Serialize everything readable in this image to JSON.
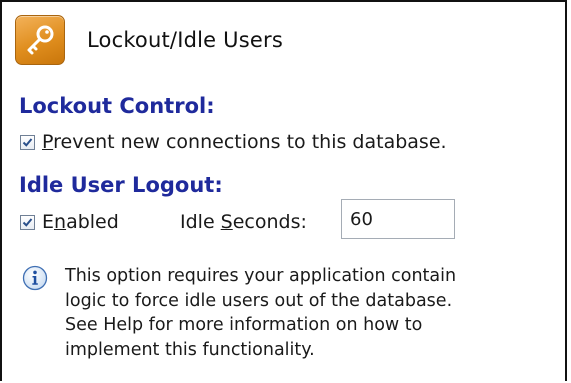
{
  "header": {
    "title": "Lockout/Idle Users",
    "icon": "key-icon",
    "icon_color": "#e08e1e"
  },
  "lockout": {
    "heading": "Lockout Control:",
    "prevent_checkbox": {
      "checked": true,
      "label_mnemonic": "P",
      "label_rest": "revent new connections to this database."
    }
  },
  "idle": {
    "heading": "Idle User Logout:",
    "enabled_checkbox": {
      "checked": true,
      "label_first": "E",
      "label_mnemonic": "n",
      "label_rest": "abled"
    },
    "seconds_label_first": "Idle ",
    "seconds_label_mnemonic": "S",
    "seconds_label_rest": "econds:",
    "seconds_value": "60"
  },
  "info": {
    "icon": "info-icon",
    "lines": [
      "This option requires your application contain",
      "logic to force idle users out of the database.",
      "See Help for more information on how to",
      "implement this functionality."
    ]
  },
  "colors": {
    "heading": "#1f2a9c",
    "border": "#111111"
  }
}
